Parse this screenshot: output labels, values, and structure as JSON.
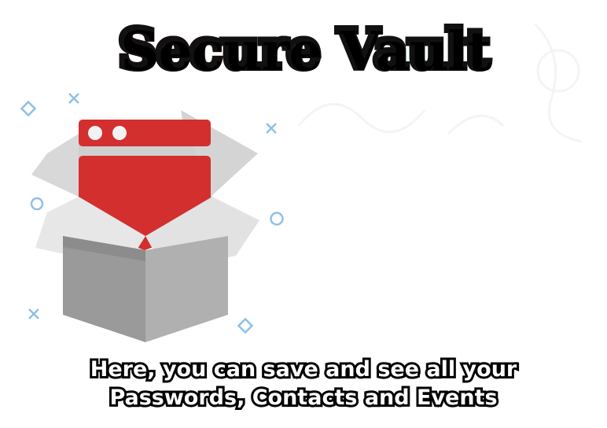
{
  "title": {
    "word1": "Secure",
    "word2": "Vault"
  },
  "caption": {
    "line1": "Here, you can save and see all your",
    "line2": "Passwords, Contacts and Events"
  },
  "colors": {
    "box_red": "#d32f2f",
    "box_grey_dark": "#8f8f8f",
    "box_grey_mid": "#bdbdbd",
    "box_grey_light": "#e6e6e6",
    "accent_blue": "#6fa9d8"
  },
  "icons": [
    "open-box-illustration",
    "browser-window-icon",
    "diamond-icon",
    "cross-icon",
    "circle-icon"
  ]
}
